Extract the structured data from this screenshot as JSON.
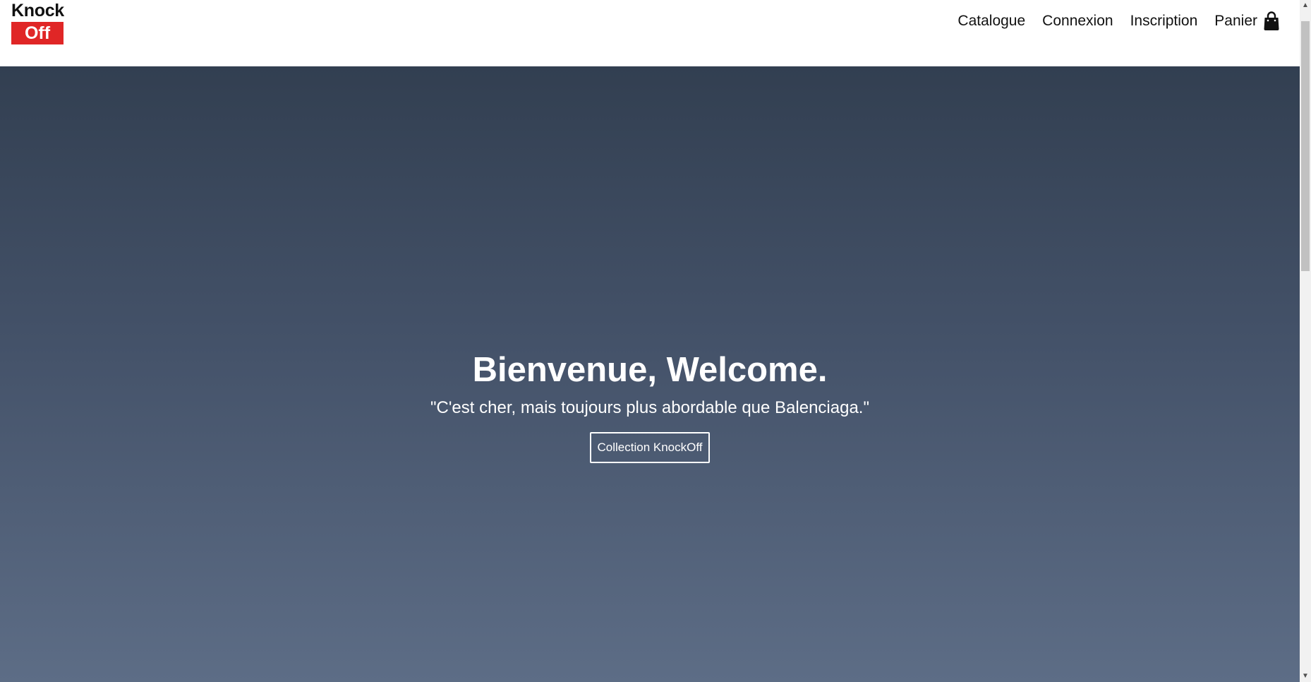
{
  "logo": {
    "top": "Knock",
    "bottom": "Off",
    "accent_color": "#e02626"
  },
  "nav": {
    "items": [
      {
        "label": "Catalogue"
      },
      {
        "label": "Connexion"
      },
      {
        "label": "Inscription"
      }
    ],
    "cart": {
      "label": "Panier",
      "icon": "shopping-bag-icon"
    }
  },
  "hero": {
    "title": "Bienvenue, Welcome.",
    "quote": "\"C'est cher, mais toujours plus abordable que Balenciaga.\"",
    "button_label": "Collection KnockOff",
    "gradient_top": "#323f51",
    "gradient_bottom": "#5d6d86"
  },
  "scrollbar": {
    "up_icon": "chevron-up-icon",
    "down_icon": "chevron-down-icon"
  }
}
